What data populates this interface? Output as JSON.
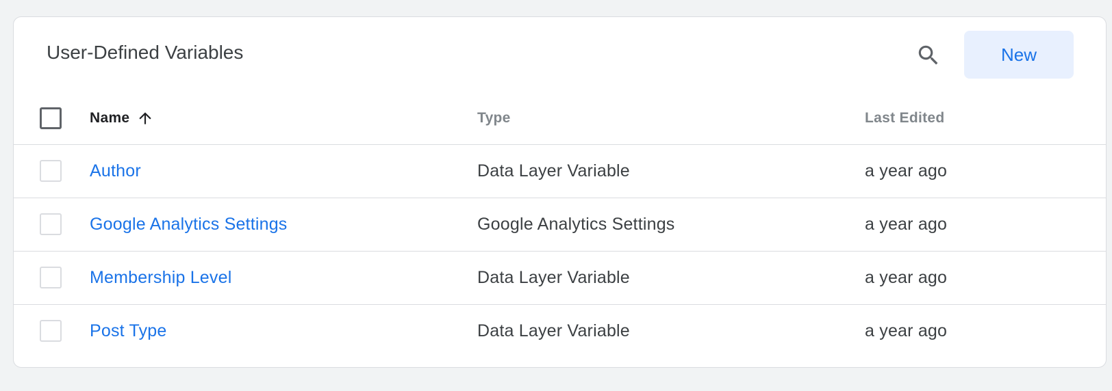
{
  "header": {
    "title": "User-Defined Variables",
    "new_label": "New"
  },
  "icons": {
    "search": "search-icon",
    "sort": "arrow-up-icon"
  },
  "colors": {
    "accent": "#1a73e8",
    "button_bg": "#e8f0fe",
    "divider": "#dadce0"
  },
  "table": {
    "columns": [
      "Name",
      "Type",
      "Last Edited"
    ],
    "sort": {
      "column": "Name",
      "direction": "ascending"
    },
    "rows": [
      {
        "name": "Author",
        "type": "Data Layer Variable",
        "edited": "a year ago"
      },
      {
        "name": "Google Analytics Settings",
        "type": "Google Analytics Settings",
        "edited": "a year ago"
      },
      {
        "name": "Membership Level",
        "type": "Data Layer Variable",
        "edited": "a year ago"
      },
      {
        "name": "Post Type",
        "type": "Data Layer Variable",
        "edited": "a year ago"
      }
    ]
  }
}
